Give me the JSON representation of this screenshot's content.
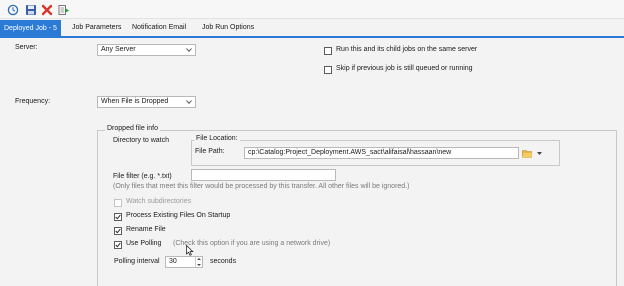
{
  "toolbar": {
    "icons": [
      "history-icon",
      "save-icon",
      "delete-icon",
      "run-job-icon"
    ]
  },
  "tabs": [
    {
      "label": "Deployed Job - 5",
      "active": true
    },
    {
      "label": "Job Parameters",
      "active": false
    },
    {
      "label": "Notification Email",
      "active": false
    },
    {
      "label": "Job Run Options",
      "active": false
    }
  ],
  "server": {
    "label": "Server:",
    "value": "Any Server",
    "run_child_label": "Run this and its child jobs on the same server",
    "run_child_checked": false,
    "skip_label": "Skip if previous job is still queued or running",
    "skip_checked": false
  },
  "frequency": {
    "label": "Frequency:",
    "value": "When File is Dropped"
  },
  "dropped": {
    "group_title": "Dropped file info",
    "directory_label": "Directory to watch",
    "location_title": "File Location:",
    "path_label": "File Path:",
    "path_value": "cp:\\Catalog:Project_Deployment.AWS_sact\\alifaisal\\hassaan\\new",
    "filter_label": "File filter (e.g. *.txt)",
    "filter_value": "",
    "filter_note": "(Only files that meet this filter would be processed by this transfer. All other files will be ignored.)",
    "watch_sub_label": "Watch subdirectories",
    "watch_sub_checked": false,
    "process_existing_label": "Process Existing Files On Startup",
    "process_existing_checked": true,
    "rename_label": "Rename File",
    "rename_checked": true,
    "polling_label": "Use Polling",
    "polling_checked": true,
    "polling_note": "(Check this option if you are using a network drive)",
    "interval_label": "Polling interval",
    "interval_value": "30",
    "interval_unit": "seconds"
  },
  "colors": {
    "accent": "#2b7bd6",
    "delete": "#d9342b",
    "save": "#3a5fa8"
  }
}
